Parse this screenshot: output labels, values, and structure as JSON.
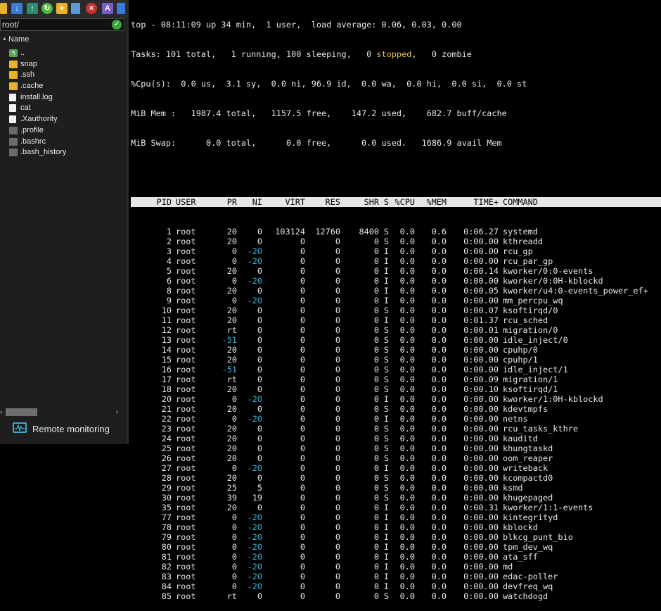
{
  "file_panel": {
    "path": "root/",
    "column_header": "Name",
    "files": [
      {
        "name": "..",
        "icon": "parent-folder-icon",
        "kind": "up"
      },
      {
        "name": "snap",
        "icon": "folder-icon",
        "kind": "folder"
      },
      {
        "name": ".ssh",
        "icon": "folder-icon",
        "kind": "folder"
      },
      {
        "name": ".cache",
        "icon": "folder-icon",
        "kind": "folder"
      },
      {
        "name": "install.log",
        "icon": "document-icon",
        "kind": "doc"
      },
      {
        "name": "cat",
        "icon": "document-icon",
        "kind": "doc"
      },
      {
        "name": ".Xauthority",
        "icon": "document-icon",
        "kind": "doc"
      },
      {
        "name": ".profile",
        "icon": "hidden-file-icon",
        "kind": "dot"
      },
      {
        "name": ".bashrc",
        "icon": "hidden-file-icon",
        "kind": "dot"
      },
      {
        "name": ".bash_history",
        "icon": "hidden-file-icon",
        "kind": "dot"
      }
    ],
    "remote_label": "Remote monitoring"
  },
  "top": {
    "line1": "top - 08:11:09 up 34 min,  1 user,  load average: 0.06, 0.03, 0.00",
    "tasks_prefix": "Tasks: 101 total,   1 running, 100 sleeping,   0 ",
    "tasks_stopped": "stopped",
    "tasks_suffix": ",   0 zombie",
    "cpu": "%Cpu(s):  0.0 us,  3.1 sy,  0.0 ni, 96.9 id,  0.0 wa,  0.0 hi,  0.0 si,  0.0 st",
    "mem": "MiB Mem :   1987.4 total,   1157.5 free,    147.2 used,    682.7 buff/cache",
    "swap": "MiB Swap:      0.0 total,      0.0 free,      0.0 used.   1686.9 avail Mem",
    "columns": [
      "PID",
      "USER",
      "PR",
      "NI",
      "VIRT",
      "RES",
      "SHR",
      "S",
      "%CPU",
      "%MEM",
      "TIME+",
      "COMMAND"
    ],
    "processes": [
      [
        "1",
        "root",
        "20",
        "0",
        "103124",
        "12760",
        "8400",
        "S",
        "0.0",
        "0.6",
        "0:06.27",
        "systemd"
      ],
      [
        "2",
        "root",
        "20",
        "0",
        "0",
        "0",
        "0",
        "S",
        "0.0",
        "0.0",
        "0:00.00",
        "kthreadd"
      ],
      [
        "3",
        "root",
        "0",
        "-20",
        "0",
        "0",
        "0",
        "I",
        "0.0",
        "0.0",
        "0:00.00",
        "rcu_gp"
      ],
      [
        "4",
        "root",
        "0",
        "-20",
        "0",
        "0",
        "0",
        "I",
        "0.0",
        "0.0",
        "0:00.00",
        "rcu_par_gp"
      ],
      [
        "5",
        "root",
        "20",
        "0",
        "0",
        "0",
        "0",
        "I",
        "0.0",
        "0.0",
        "0:00.14",
        "kworker/0:0-events"
      ],
      [
        "6",
        "root",
        "0",
        "-20",
        "0",
        "0",
        "0",
        "I",
        "0.0",
        "0.0",
        "0:00.00",
        "kworker/0:0H-kblockd"
      ],
      [
        "8",
        "root",
        "20",
        "0",
        "0",
        "0",
        "0",
        "I",
        "0.0",
        "0.0",
        "0:00.05",
        "kworker/u4:0-events_power_ef+"
      ],
      [
        "9",
        "root",
        "0",
        "-20",
        "0",
        "0",
        "0",
        "I",
        "0.0",
        "0.0",
        "0:00.00",
        "mm_percpu_wq"
      ],
      [
        "10",
        "root",
        "20",
        "0",
        "0",
        "0",
        "0",
        "S",
        "0.0",
        "0.0",
        "0:00.07",
        "ksoftirqd/0"
      ],
      [
        "11",
        "root",
        "20",
        "0",
        "0",
        "0",
        "0",
        "I",
        "0.0",
        "0.0",
        "0:01.37",
        "rcu_sched"
      ],
      [
        "12",
        "root",
        "rt",
        "0",
        "0",
        "0",
        "0",
        "S",
        "0.0",
        "0.0",
        "0:00.01",
        "migration/0"
      ],
      [
        "13",
        "root",
        "-51",
        "0",
        "0",
        "0",
        "0",
        "S",
        "0.0",
        "0.0",
        "0:00.00",
        "idle_inject/0"
      ],
      [
        "14",
        "root",
        "20",
        "0",
        "0",
        "0",
        "0",
        "S",
        "0.0",
        "0.0",
        "0:00.00",
        "cpuhp/0"
      ],
      [
        "15",
        "root",
        "20",
        "0",
        "0",
        "0",
        "0",
        "S",
        "0.0",
        "0.0",
        "0:00.00",
        "cpuhp/1"
      ],
      [
        "16",
        "root",
        "-51",
        "0",
        "0",
        "0",
        "0",
        "S",
        "0.0",
        "0.0",
        "0:00.00",
        "idle_inject/1"
      ],
      [
        "17",
        "root",
        "rt",
        "0",
        "0",
        "0",
        "0",
        "S",
        "0.0",
        "0.0",
        "0:00.09",
        "migration/1"
      ],
      [
        "18",
        "root",
        "20",
        "0",
        "0",
        "0",
        "0",
        "S",
        "0.0",
        "0.0",
        "0:00.10",
        "ksoftirqd/1"
      ],
      [
        "20",
        "root",
        "0",
        "-20",
        "0",
        "0",
        "0",
        "I",
        "0.0",
        "0.0",
        "0:00.00",
        "kworker/1:0H-kblockd"
      ],
      [
        "21",
        "root",
        "20",
        "0",
        "0",
        "0",
        "0",
        "S",
        "0.0",
        "0.0",
        "0:00.00",
        "kdevtmpfs"
      ],
      [
        "22",
        "root",
        "0",
        "-20",
        "0",
        "0",
        "0",
        "I",
        "0.0",
        "0.0",
        "0:00.00",
        "netns"
      ],
      [
        "23",
        "root",
        "20",
        "0",
        "0",
        "0",
        "0",
        "S",
        "0.0",
        "0.0",
        "0:00.00",
        "rcu_tasks_kthre"
      ],
      [
        "24",
        "root",
        "20",
        "0",
        "0",
        "0",
        "0",
        "S",
        "0.0",
        "0.0",
        "0:00.00",
        "kauditd"
      ],
      [
        "25",
        "root",
        "20",
        "0",
        "0",
        "0",
        "0",
        "S",
        "0.0",
        "0.0",
        "0:00.00",
        "khungtaskd"
      ],
      [
        "26",
        "root",
        "20",
        "0",
        "0",
        "0",
        "0",
        "S",
        "0.0",
        "0.0",
        "0:00.00",
        "oom_reaper"
      ],
      [
        "27",
        "root",
        "0",
        "-20",
        "0",
        "0",
        "0",
        "I",
        "0.0",
        "0.0",
        "0:00.00",
        "writeback"
      ],
      [
        "28",
        "root",
        "20",
        "0",
        "0",
        "0",
        "0",
        "S",
        "0.0",
        "0.0",
        "0:00.00",
        "kcompactd0"
      ],
      [
        "29",
        "root",
        "25",
        "5",
        "0",
        "0",
        "0",
        "S",
        "0.0",
        "0.0",
        "0:00.00",
        "ksmd"
      ],
      [
        "30",
        "root",
        "39",
        "19",
        "0",
        "0",
        "0",
        "S",
        "0.0",
        "0.0",
        "0:00.00",
        "khugepaged"
      ],
      [
        "35",
        "root",
        "20",
        "0",
        "0",
        "0",
        "0",
        "I",
        "0.0",
        "0.0",
        "0:00.31",
        "kworker/1:1-events"
      ],
      [
        "77",
        "root",
        "0",
        "-20",
        "0",
        "0",
        "0",
        "I",
        "0.0",
        "0.0",
        "0:00.00",
        "kintegrityd"
      ],
      [
        "78",
        "root",
        "0",
        "-20",
        "0",
        "0",
        "0",
        "I",
        "0.0",
        "0.0",
        "0:00.00",
        "kblockd"
      ],
      [
        "79",
        "root",
        "0",
        "-20",
        "0",
        "0",
        "0",
        "I",
        "0.0",
        "0.0",
        "0:00.00",
        "blkcg_punt_bio"
      ],
      [
        "80",
        "root",
        "0",
        "-20",
        "0",
        "0",
        "0",
        "I",
        "0.0",
        "0.0",
        "0:00.00",
        "tpm_dev_wq"
      ],
      [
        "81",
        "root",
        "0",
        "-20",
        "0",
        "0",
        "0",
        "I",
        "0.0",
        "0.0",
        "0:00.00",
        "ata_sff"
      ],
      [
        "82",
        "root",
        "0",
        "-20",
        "0",
        "0",
        "0",
        "I",
        "0.0",
        "0.0",
        "0:00.00",
        "md"
      ],
      [
        "83",
        "root",
        "0",
        "-20",
        "0",
        "0",
        "0",
        "I",
        "0.0",
        "0.0",
        "0:00.00",
        "edac-poller"
      ],
      [
        "84",
        "root",
        "0",
        "-20",
        "0",
        "0",
        "0",
        "I",
        "0.0",
        "0.0",
        "0:00.00",
        "devfreq_wq"
      ],
      [
        "85",
        "root",
        "rt",
        "0",
        "0",
        "0",
        "0",
        "S",
        "0.0",
        "0.0",
        "0:00.00",
        "watchdogd"
      ]
    ]
  },
  "colors": {
    "highlight": "#e8c54a",
    "cyan": "#3cb5d6",
    "folder": "#e9b22c"
  }
}
